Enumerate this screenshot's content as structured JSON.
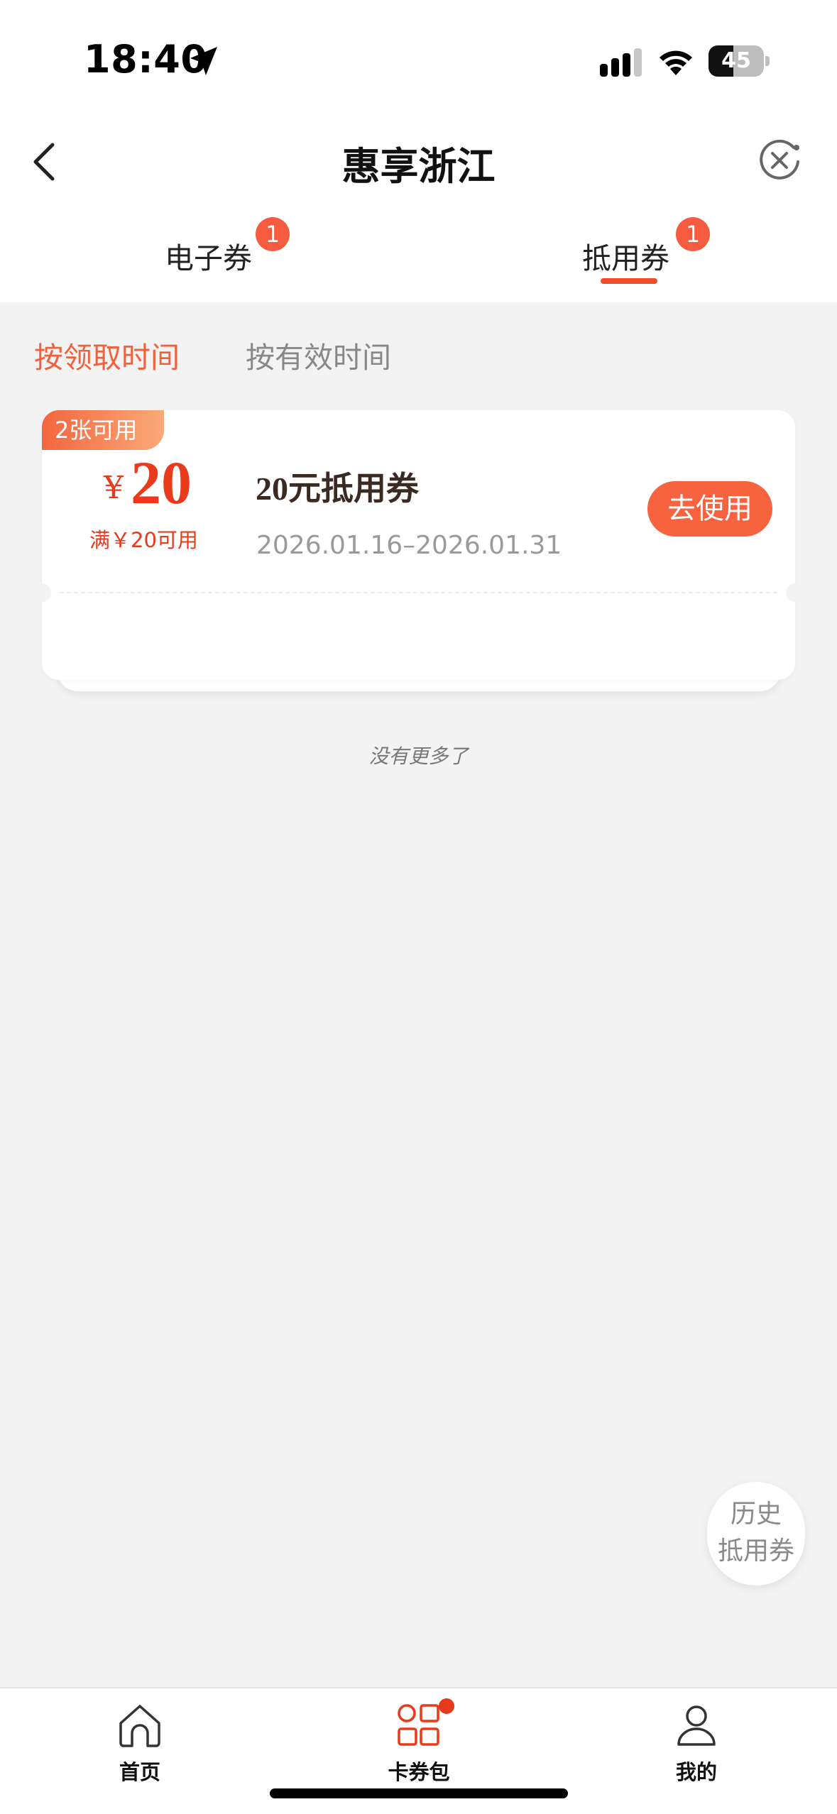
{
  "status_bar": {
    "time": "18:40",
    "battery_percent": "45",
    "battery_level": 0.45
  },
  "nav": {
    "title": "惠享浙江",
    "back_icon": "chevron-left-icon",
    "close_icon": "close-mini-program-icon"
  },
  "tabs": [
    {
      "label": "电子券",
      "badge": "1",
      "active": false
    },
    {
      "label": "抵用券",
      "badge": "1",
      "active": true
    }
  ],
  "sort_options": [
    {
      "label": "按领取时间",
      "active": true
    },
    {
      "label": "按有效时间",
      "active": false
    }
  ],
  "coupon": {
    "count_badge": "2张可用",
    "currency": "¥",
    "amount": "20",
    "condition": "满￥20可用",
    "title": "20元抵用券",
    "validity": "2026.01.16–2026.01.31",
    "action": "去使用"
  },
  "list_end_text": "没有更多了",
  "history_button": {
    "line1": "历史",
    "line2": "抵用券"
  },
  "tabbar": [
    {
      "label": "首页",
      "icon": "home-icon"
    },
    {
      "label": "卡券包",
      "icon": "wallet-grid-icon",
      "active": true,
      "dot": true
    },
    {
      "label": "我的",
      "icon": "user-icon"
    }
  ],
  "colors": {
    "accent": "#f7623f",
    "price": "#e93a1c",
    "background": "#f3f3f3"
  }
}
